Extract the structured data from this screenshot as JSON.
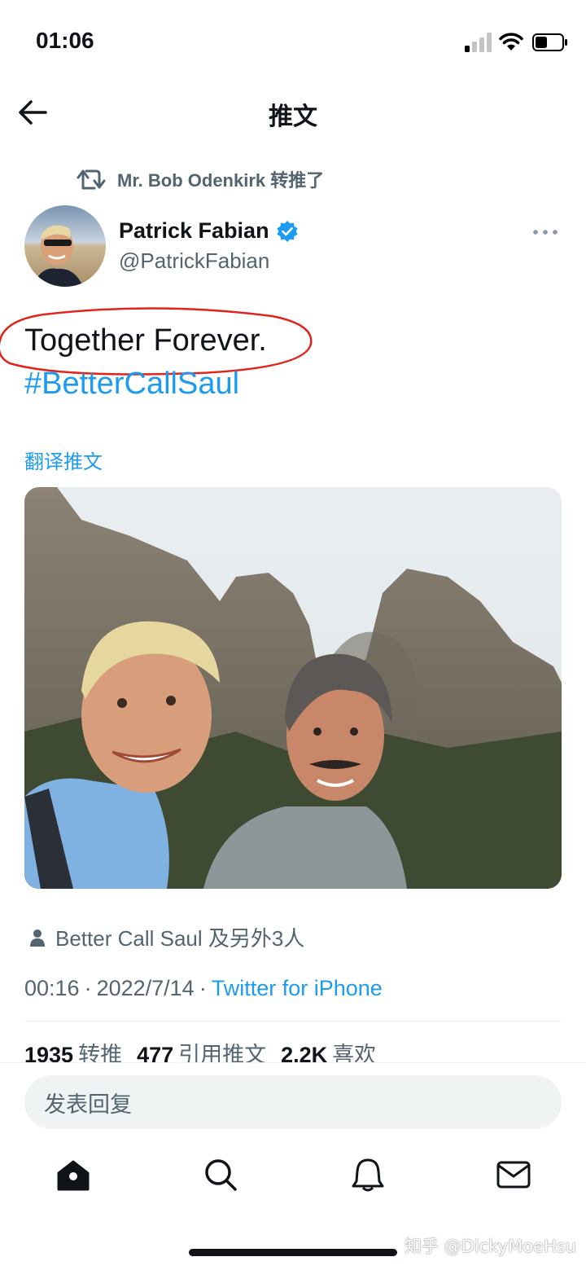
{
  "status_bar": {
    "time": "01:06"
  },
  "header": {
    "title": "推文"
  },
  "retweet": {
    "text": "Mr. Bob Odenkirk 转推了"
  },
  "author": {
    "name": "Patrick Fabian",
    "handle": "@PatrickFabian"
  },
  "tweet": {
    "text": "Together Forever.",
    "hashtag": "#BetterCallSaul",
    "translate_label": "翻译推文"
  },
  "liked_by": {
    "text": "Better Call Saul 及另外3人"
  },
  "meta": {
    "time": "00:16",
    "separator": "·",
    "date": "2022/7/14",
    "source": "Twitter for iPhone"
  },
  "stats": {
    "retweets": "1935",
    "retweets_label": "转推",
    "quotes": "477",
    "quotes_label": "引用推文",
    "likes": "2.2K",
    "likes_label": "喜欢"
  },
  "reply": {
    "placeholder": "发表回复"
  },
  "tabs": [
    "home-icon",
    "search-icon",
    "bell-icon",
    "mail-icon"
  ],
  "watermark": "知乎 @DickyMoeHsu",
  "colors": {
    "accent": "#1d9bf0",
    "secondary_text": "#536471",
    "highlight_circle": "#e0241b"
  }
}
